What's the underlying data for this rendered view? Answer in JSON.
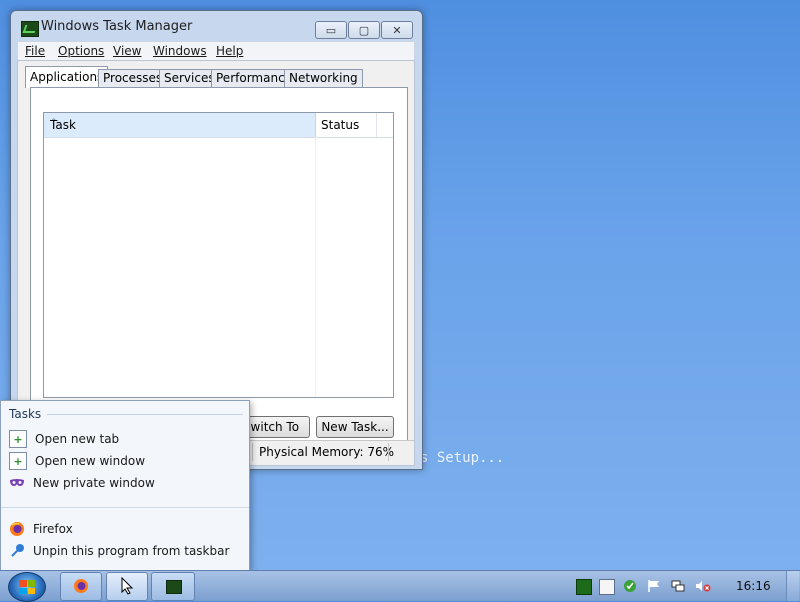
{
  "desktop": {
    "background_text": "s Setup..."
  },
  "window": {
    "title": "Windows Task Manager",
    "controls": {
      "minimize": "▭",
      "maximize": "▢",
      "close": "✕"
    },
    "menu": [
      "File",
      "Options",
      "View",
      "Windows",
      "Help"
    ],
    "tabs": [
      "Applications",
      "Processes",
      "Services",
      "Performance",
      "Networking"
    ],
    "active_tab": "Applications",
    "list": {
      "columns": [
        "Task",
        "Status"
      ],
      "sort_indicator": "^",
      "rows": []
    },
    "buttons": {
      "end_task": "",
      "switch_to": "Switch To",
      "new_task": "New Task..."
    },
    "statusbar": {
      "physical_memory": "Physical Memory: 76%"
    }
  },
  "jumplist": {
    "heading": "Tasks",
    "tasks": [
      {
        "label": "Open new tab",
        "icon": "plus-tab-icon"
      },
      {
        "label": "Open new window",
        "icon": "plus-window-icon"
      },
      {
        "label": "New private window",
        "icon": "private-mask-icon"
      }
    ],
    "pinned": [
      {
        "label": "Firefox",
        "icon": "firefox-icon"
      },
      {
        "label": "Unpin this program from taskbar",
        "icon": "unpin-icon"
      }
    ]
  },
  "taskbar": {
    "clock": "16:16"
  },
  "colors": {
    "accent": "#2a6fbf",
    "desktop": "#6aa3ea",
    "selected_header": "#dcebfc"
  }
}
